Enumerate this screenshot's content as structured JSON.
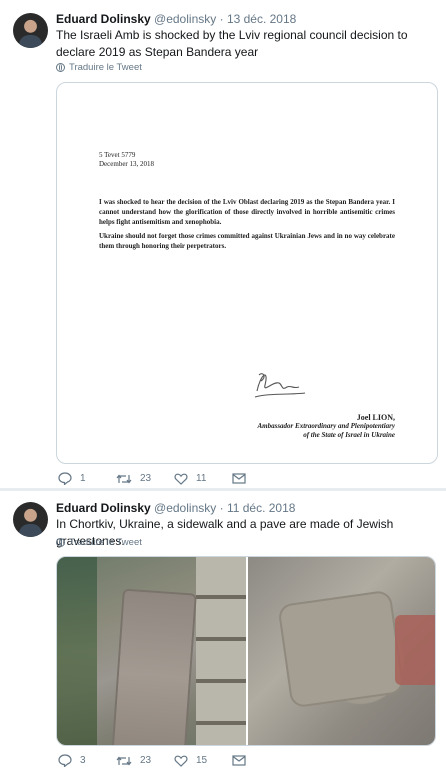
{
  "tweets": [
    {
      "author_name": "Eduard Dolinsky",
      "handle": "@edolinsky",
      "separator": "·",
      "date": "13 déc. 2018",
      "text": "The Israeli Amb is shocked by the Lviv regional council decision to declare 2019 as Stepan Bandera year",
      "translate_label": "Traduire le Tweet",
      "letter": {
        "date_line1": "5 Tevet 5779",
        "date_line2": "December 13, 2018",
        "paragraph1": "I was shocked to hear the decision of the Lviv Oblast declaring 2019 as the Stepan Bandera year. I cannot understand how the glorification of those directly involved in horrible antisemitic crimes helps fight antisemitism and xenophobia.",
        "paragraph2": "Ukraine should not forget those crimes committed against Ukrainian Jews and in no way celebrate them through honoring their perpetrators.",
        "signer_name": "Joel LION,",
        "signer_title1": "Ambassador Extraordinary and Plenipotentiary",
        "signer_title2": "of the State of Israel in Ukraine"
      },
      "replies": "1",
      "retweets": "23",
      "likes": "11"
    },
    {
      "author_name": "Eduard Dolinsky",
      "handle": "@edolinsky",
      "separator": "·",
      "date": "11 déc. 2018",
      "text": "In Chortkiv, Ukraine, a sidewalk and a pave are made of Jewish gravestones.",
      "translate_label": "Traduire le Tweet",
      "replies": "3",
      "retweets": "23",
      "likes": "15"
    }
  ],
  "colors": {
    "background": "#e6ecf0",
    "card": "#ffffff",
    "secondary_text": "#657786",
    "border": "#ccd6dd"
  }
}
